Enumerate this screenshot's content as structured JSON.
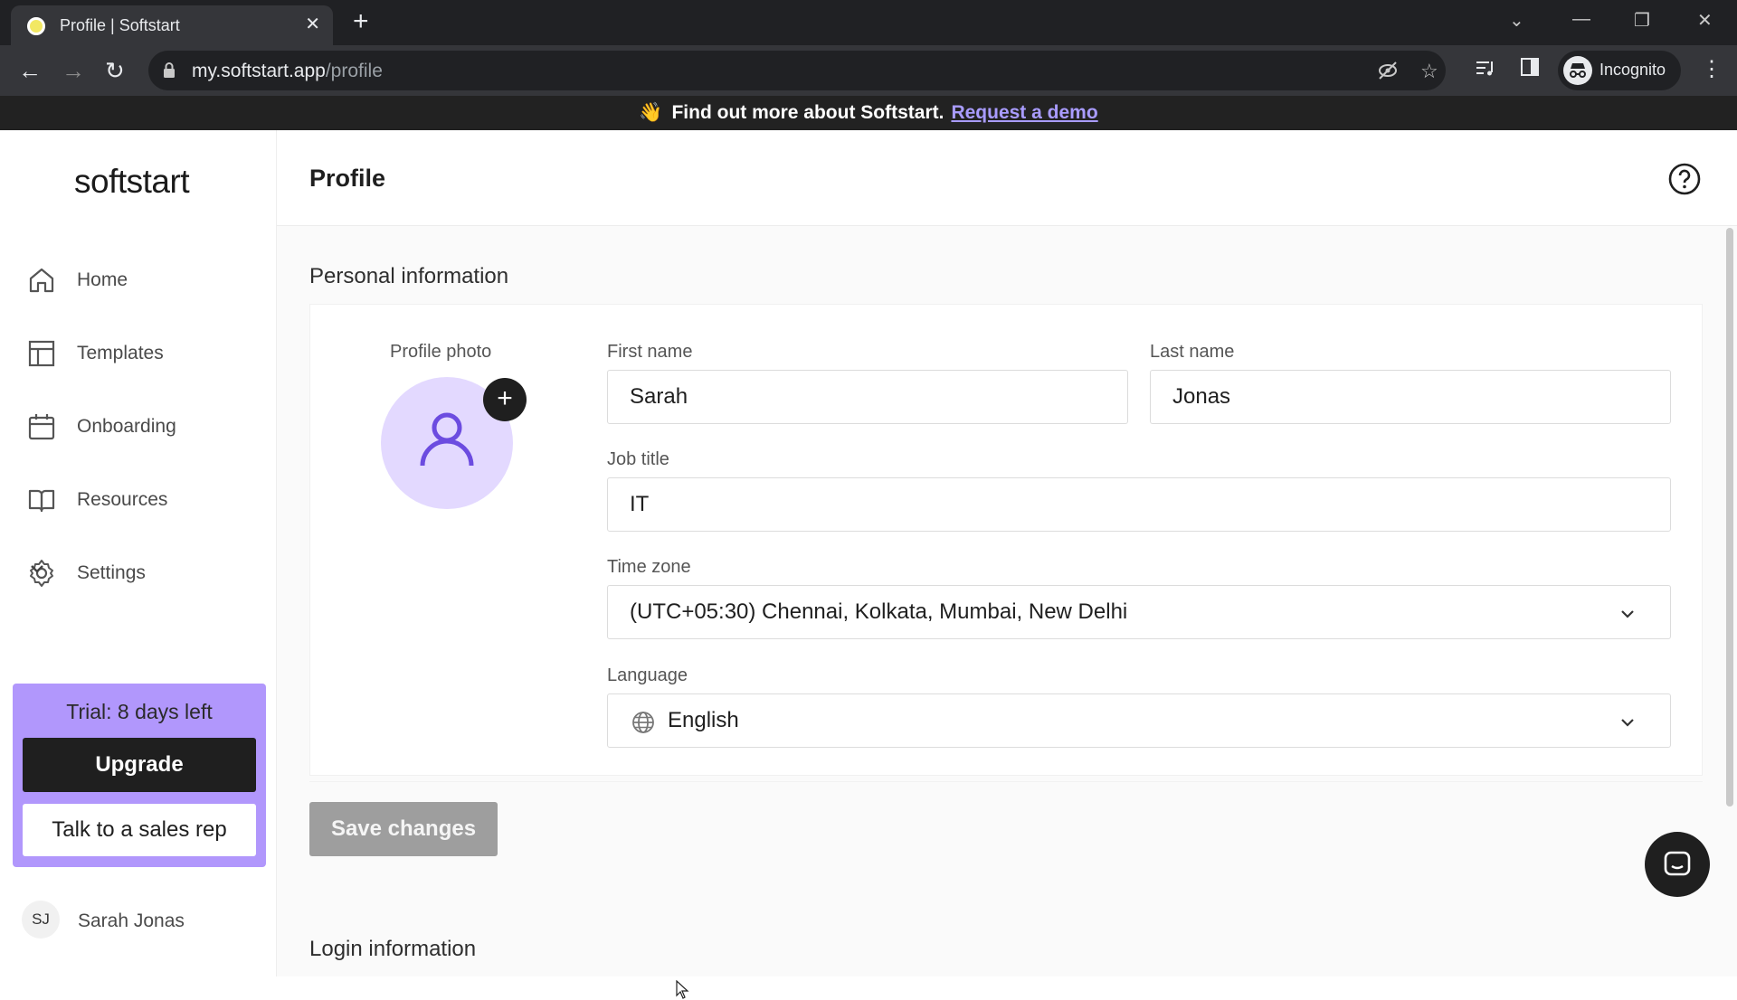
{
  "browser": {
    "tab_title": "Profile | Softstart",
    "url_host": "my.softstart.app",
    "url_path": "/profile",
    "incognito_label": "Incognito"
  },
  "banner": {
    "text": "Find out more about Softstart.",
    "link": "Request a demo"
  },
  "sidebar": {
    "logo": "softstart",
    "items": [
      {
        "label": "Home",
        "icon": "home-icon"
      },
      {
        "label": "Templates",
        "icon": "templates-icon"
      },
      {
        "label": "Onboarding",
        "icon": "calendar-icon"
      },
      {
        "label": "Resources",
        "icon": "book-icon"
      },
      {
        "label": "Settings",
        "icon": "gear-icon"
      }
    ],
    "trial": {
      "text": "Trial: 8 days left",
      "upgrade": "Upgrade",
      "sales": "Talk to a sales rep"
    },
    "user": {
      "initials": "SJ",
      "name": "Sarah Jonas"
    }
  },
  "main": {
    "title": "Profile",
    "personal_section": "Personal information",
    "login_section": "Login information",
    "form": {
      "photo_label": "Profile photo",
      "first_name_label": "First name",
      "first_name": "Sarah",
      "last_name_label": "Last name",
      "last_name": "Jonas",
      "job_title_label": "Job title",
      "job_title": "IT",
      "timezone_label": "Time zone",
      "timezone": "(UTC+05:30) Chennai, Kolkata, Mumbai, New Delhi",
      "language_label": "Language",
      "language": "English",
      "save": "Save changes"
    }
  },
  "colors": {
    "accent": "#b197fc",
    "avatar_bg": "#e3d9ff",
    "avatar_fg": "#6c4ce0",
    "dark": "#1f1f1f",
    "save_disabled": "#9e9e9e"
  }
}
